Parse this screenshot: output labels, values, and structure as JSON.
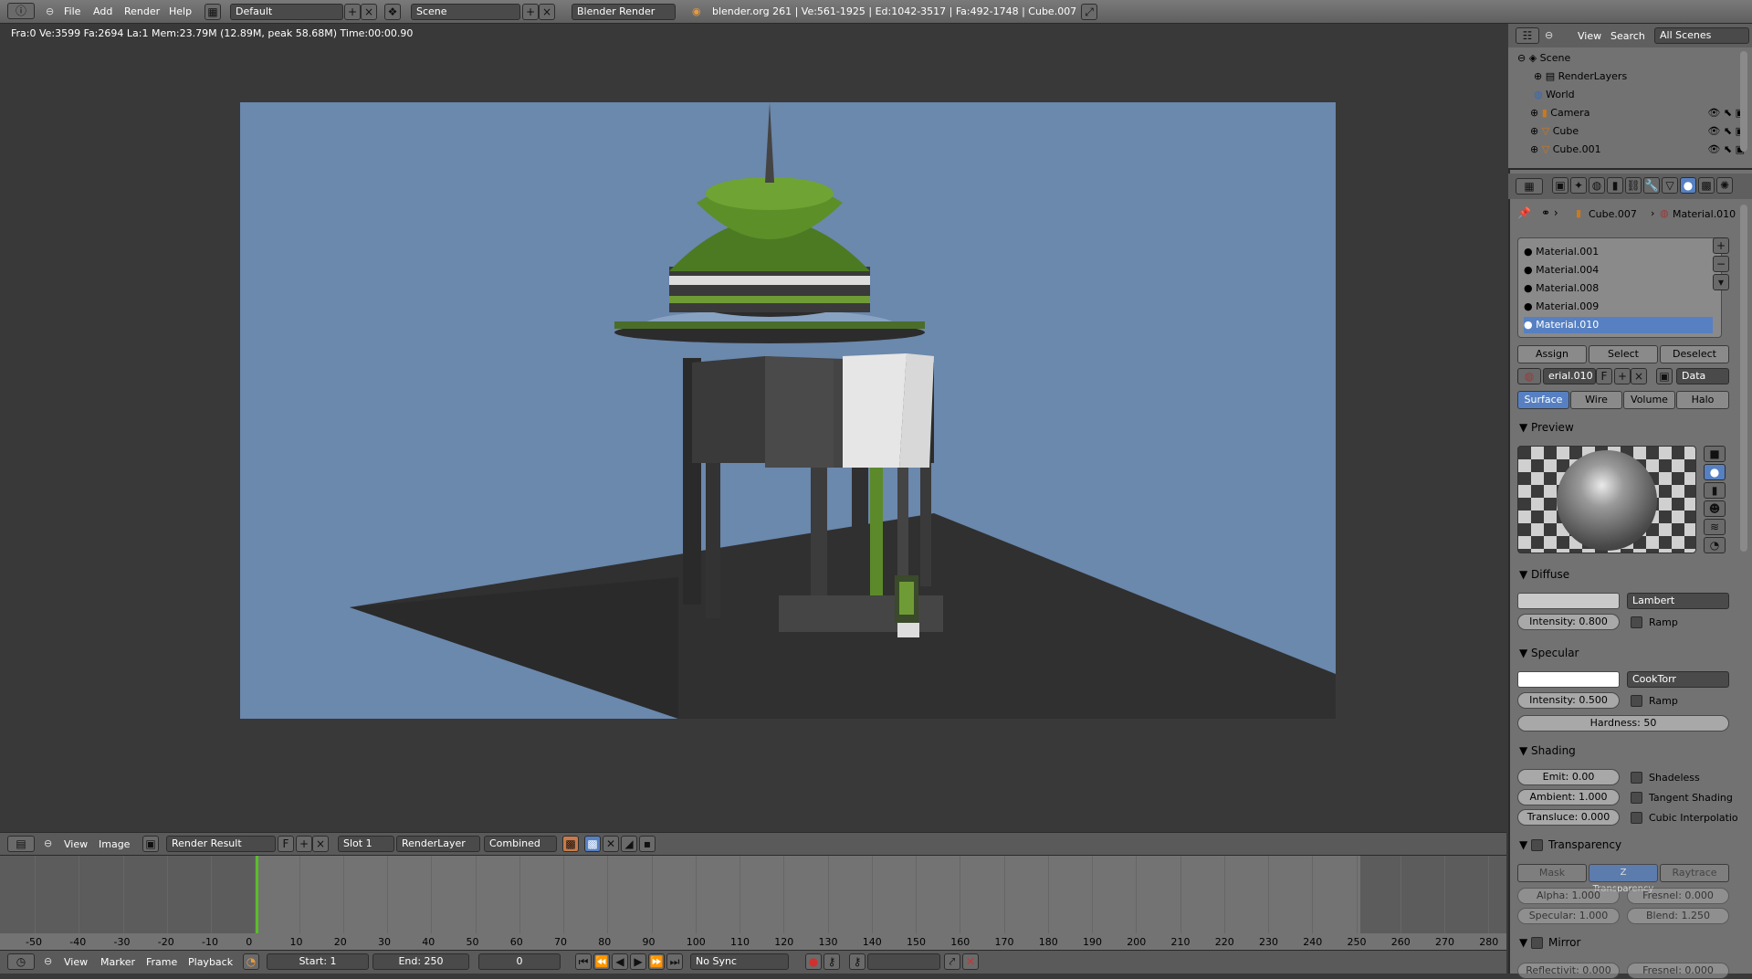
{
  "menubar": {
    "menus": [
      "File",
      "Add",
      "Render",
      "Help"
    ],
    "screen_layout": "Default",
    "scene": "Scene",
    "engine": "Blender Render",
    "stats": "blender.org 261 | Ve:561-1925 | Ed:1042-3517 | Fa:492-1748 | Cube.007"
  },
  "status_line": "Fra:0  Ve:3599 Fa:2694 La:1 Mem:23.79M (12.89M, peak 58.68M) Time:00:00.90",
  "image_editor": {
    "menus": [
      "View",
      "Image"
    ],
    "image_name": "Render Result",
    "f_label": "F",
    "slot": "Slot 1",
    "render_layer": "RenderLayer",
    "pass": "Combined"
  },
  "timeline": {
    "ticks": [
      "-50",
      "-40",
      "-30",
      "-20",
      "-10",
      "0",
      "10",
      "20",
      "30",
      "40",
      "50",
      "60",
      "70",
      "80",
      "90",
      "100",
      "110",
      "120",
      "130",
      "140",
      "150",
      "160",
      "170",
      "180",
      "190",
      "200",
      "210",
      "220",
      "230",
      "240",
      "250",
      "260",
      "270",
      "280"
    ],
    "current_frame_marker": 0,
    "menus": [
      "View",
      "Marker",
      "Frame",
      "Playback"
    ],
    "start": "Start: 1",
    "end": "End: 250",
    "current": "0",
    "sync": "No Sync"
  },
  "outliner": {
    "view": "View",
    "search": "Search",
    "filter": "All Scenes",
    "items": [
      {
        "label": "Scene"
      },
      {
        "label": "RenderLayers"
      },
      {
        "label": "World"
      },
      {
        "label": "Camera"
      },
      {
        "label": "Cube"
      },
      {
        "label": "Cube.001"
      }
    ]
  },
  "properties": {
    "breadcrumb_object": "Cube.007",
    "breadcrumb_material": "Material.010",
    "materials": [
      "Material.001",
      "Material.004",
      "Material.008",
      "Material.009",
      "Material.010"
    ],
    "selected_material_index": 4,
    "assign": "Assign",
    "select": "Select",
    "deselect": "Deselect",
    "material_field": "erial.010",
    "f_label": "F",
    "data_label": "Data",
    "tabs": [
      "Surface",
      "Wire",
      "Volume",
      "Halo"
    ],
    "preview_title": "Preview",
    "diffuse": {
      "title": "Diffuse",
      "shader": "Lambert",
      "intensity": "Intensity: 0.800",
      "ramp": "Ramp",
      "color": "#c9c9c9"
    },
    "specular": {
      "title": "Specular",
      "shader": "CookTorr",
      "intensity": "Intensity: 0.500",
      "ramp": "Ramp",
      "hardness": "Hardness: 50",
      "color": "#ffffff"
    },
    "shading": {
      "title": "Shading",
      "emit": "Emit: 0.00",
      "ambient": "Ambient: 1.000",
      "transluc": "Transluce: 0.000",
      "shadeless": "Shadeless",
      "tangent": "Tangent Shading",
      "cubic": "Cubic Interpolatio"
    },
    "transparency": {
      "title": "Transparency",
      "tabs": [
        "Mask",
        "Z Transparency",
        "Raytrace"
      ],
      "alpha": "Alpha: 1.000",
      "fresnel": "Fresnel: 0.000",
      "specular": "Specular: 1.000",
      "blend": "Blend: 1.250"
    },
    "mirror": {
      "title": "Mirror",
      "reflectivity": "Reflectivit: 0.000",
      "fresnel": "Fresnel: 0.000"
    }
  },
  "colors": {
    "accent": "#5680c2",
    "render_bg": "#6b88ad",
    "frame_line": "#5cbd2a"
  }
}
